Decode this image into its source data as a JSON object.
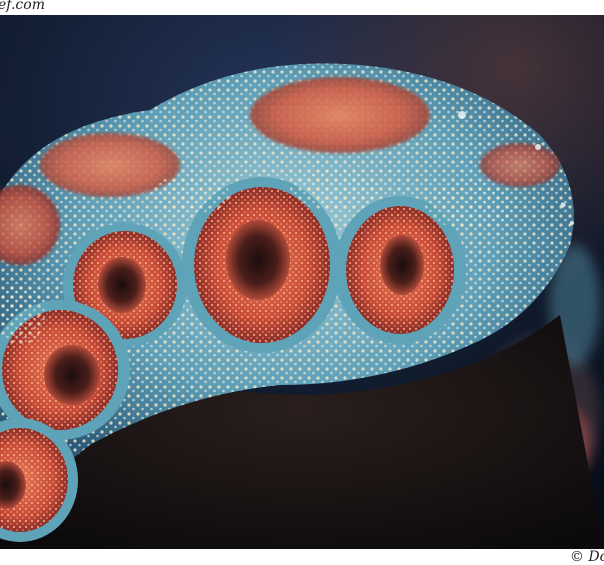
{
  "watermark_top": "ef.com",
  "watermark_bottom": "© Do",
  "colors": {
    "background_deep": "#0b1422",
    "background_blue": "#1a2a48",
    "coral_rim_teal": "#6fb5c8",
    "coral_tips_cream": "#e8e0c4",
    "coral_polyp_red": "#d0553f",
    "coral_polyp_orange": "#e0704f",
    "shadow_dark": "#1b1410"
  }
}
